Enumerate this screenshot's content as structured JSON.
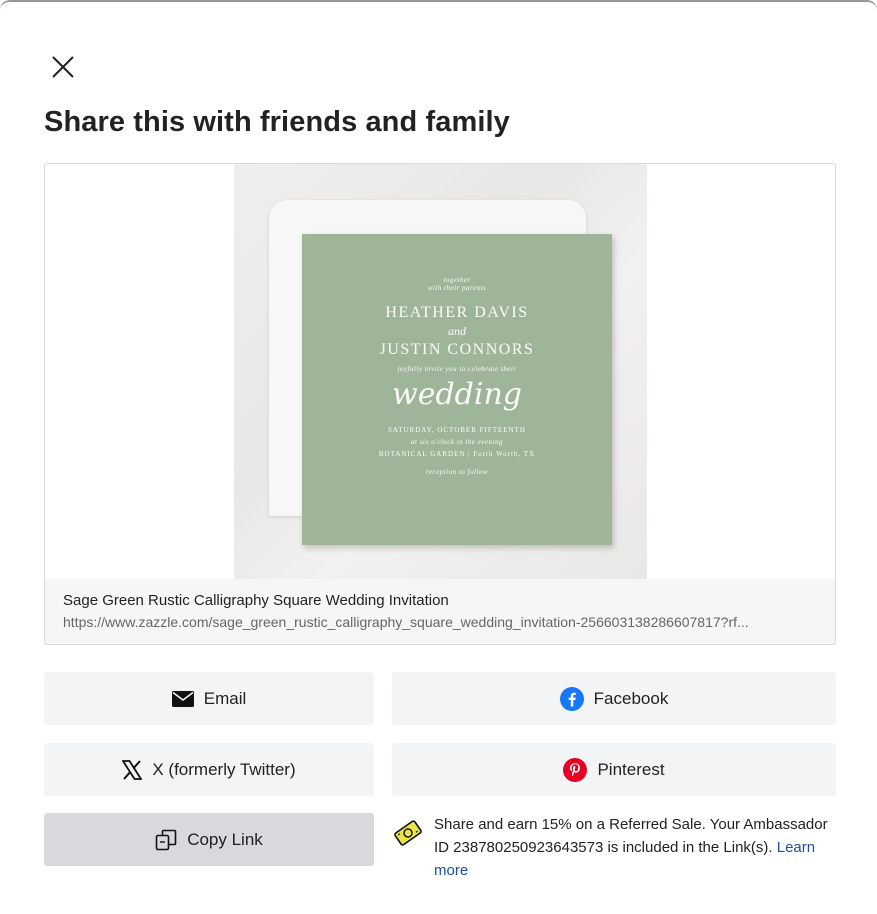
{
  "modal": {
    "title": "Share this with friends and family"
  },
  "preview": {
    "product_title": "Sage Green Rustic Calligraphy Square Wedding Invitation",
    "url": "https://www.zazzle.com/sage_green_rustic_calligraphy_square_wedding_invitation-256603138286607817?rf...",
    "card": {
      "line1": "together",
      "line2": "with their parents",
      "name1": "HEATHER DAVIS",
      "and": "and",
      "name2": "JUSTIN CONNORS",
      "invite": "joyfully invite you to celebrate their",
      "script": "wedding",
      "date": "SATURDAY, OCTOBER FIFTEENTH",
      "time": "at six o'clock in the evening",
      "venue": "BOTANICAL GARDEN | Forth Worth, TX",
      "reception": "reception to follow"
    },
    "card_color": "#9eb59a"
  },
  "share": {
    "email_label": "Email",
    "facebook_label": "Facebook",
    "x_label": "X (formerly Twitter)",
    "pinterest_label": "Pinterest",
    "copy_label": "Copy Link",
    "facebook_color": "#1877f2",
    "pinterest_color": "#e60023"
  },
  "ambassador": {
    "text": "Share and earn 15% on a Referred Sale. Your Ambassador ID 238780250923643573 is included in the Link(s).",
    "link_label": "Learn more",
    "link_color": "#1e4fa3"
  },
  "icons": [
    "close-icon",
    "email-icon",
    "facebook-icon",
    "x-icon",
    "pinterest-icon",
    "copy-icon",
    "ambassador-icon"
  ]
}
